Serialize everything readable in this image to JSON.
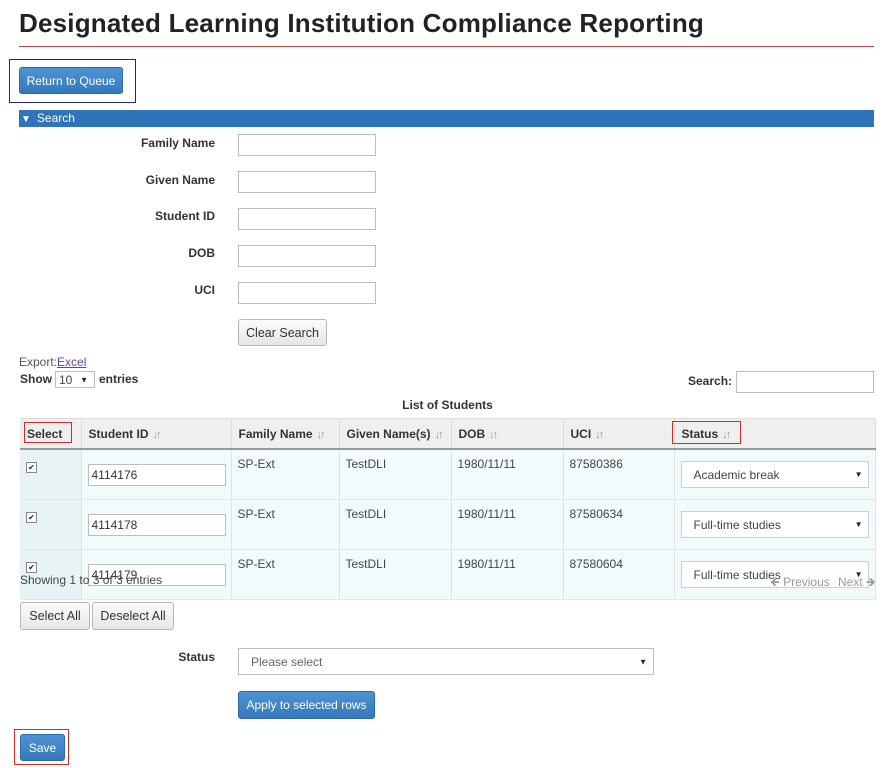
{
  "page": {
    "title": "Designated Learning Institution Compliance Reporting",
    "return_label": "Return to Queue"
  },
  "search": {
    "header": "Search",
    "fields": [
      {
        "label": "Family Name",
        "value": ""
      },
      {
        "label": "Given Name",
        "value": ""
      },
      {
        "label": "Student ID",
        "value": ""
      },
      {
        "label": "DOB",
        "value": ""
      },
      {
        "label": "UCI",
        "value": ""
      }
    ],
    "clear_label": "Clear Search"
  },
  "export": {
    "label": "Export:",
    "link": "Excel"
  },
  "length": {
    "show": "Show",
    "value": "10",
    "entries": "entries"
  },
  "filter": {
    "label": "Search:",
    "value": ""
  },
  "table": {
    "caption": "List of Students",
    "columns": [
      "Select",
      "Student ID",
      "Family Name",
      "Given Name(s)",
      "DOB",
      "UCI",
      "Status"
    ],
    "rows": [
      {
        "checked": true,
        "student_id": "4114176",
        "family": "SP-Ext",
        "given": "TestDLI",
        "dob": "1980/11/11",
        "uci": "87580386",
        "status": "Academic break"
      },
      {
        "checked": true,
        "student_id": "4114178",
        "family": "SP-Ext",
        "given": "TestDLI",
        "dob": "1980/11/11",
        "uci": "87580634",
        "status": "Full-time studies"
      },
      {
        "checked": true,
        "student_id": "4114179",
        "family": "SP-Ext",
        "given": "TestDLI",
        "dob": "1980/11/11",
        "uci": "87580604",
        "status": "Full-time studies"
      }
    ],
    "info": "Showing 1 to 3 of 3 entries",
    "previous": "Previous",
    "next": "Next"
  },
  "bulk": {
    "select_all": "Select All",
    "deselect_all": "Deselect All",
    "status_label": "Status",
    "status_placeholder": "Please select",
    "apply_label": "Apply to selected rows",
    "save_label": "Save"
  },
  "colors": {
    "primary": "#3479bd",
    "highlight": "#c9302c",
    "title_rule": "#b94a48"
  }
}
